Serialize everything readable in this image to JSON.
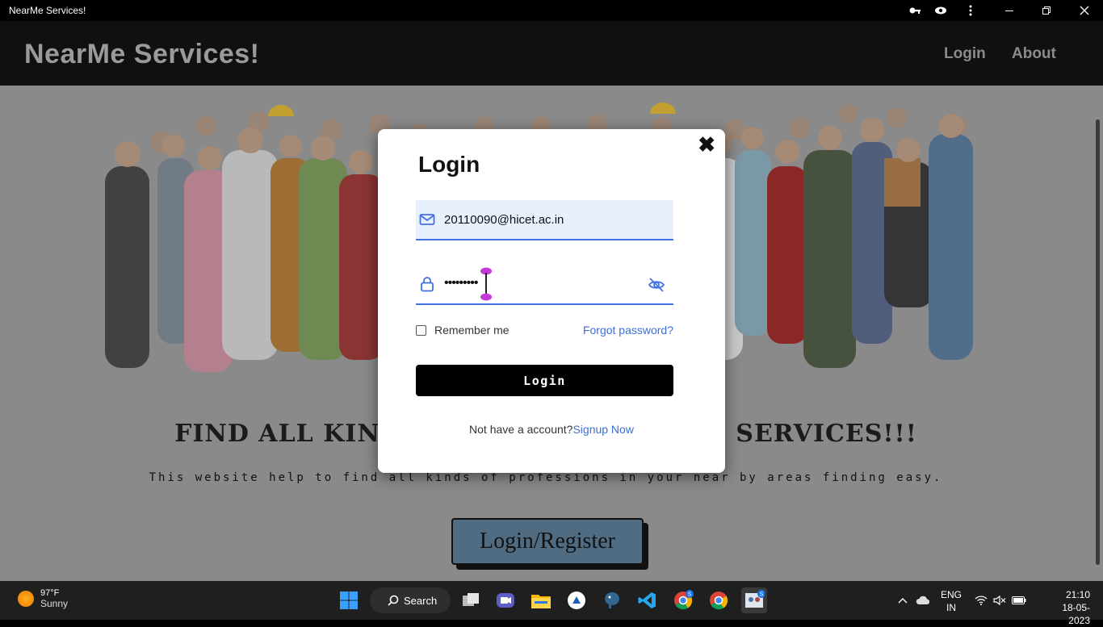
{
  "window": {
    "title": "NearMe Services!"
  },
  "navbar": {
    "brand": "NearMe Services!",
    "links": [
      "Login",
      "About"
    ]
  },
  "hero": {
    "headline": "FIND ALL KINDS OF PROFESSIONALS SERVICES!!!",
    "subline": "This website help to find all kinds of professions in your near by areas finding easy.",
    "cta": "Login/Register"
  },
  "login_modal": {
    "title": "Login",
    "close": "✖",
    "email_value": "20110090@hicet.ac.in",
    "password_masked": "•••••••••",
    "remember_label": "Remember me",
    "forgot_label": "Forgot password?",
    "submit_label": "Login",
    "signup_prompt": "Not have a account?",
    "signup_link": "Signup Now"
  },
  "taskbar": {
    "weather_temp": "97°F",
    "weather_desc": "Sunny",
    "search_label": "Search",
    "lang_top": "ENG",
    "lang_bottom": "IN",
    "time": "21:10",
    "date": "18-05-2023",
    "badge_s": "S"
  },
  "colors": {
    "accent": "#3b6fd8",
    "field_bg": "#e8f0fe",
    "overlay": "#8a8a8a",
    "cta_bg": "#4f6c82"
  }
}
